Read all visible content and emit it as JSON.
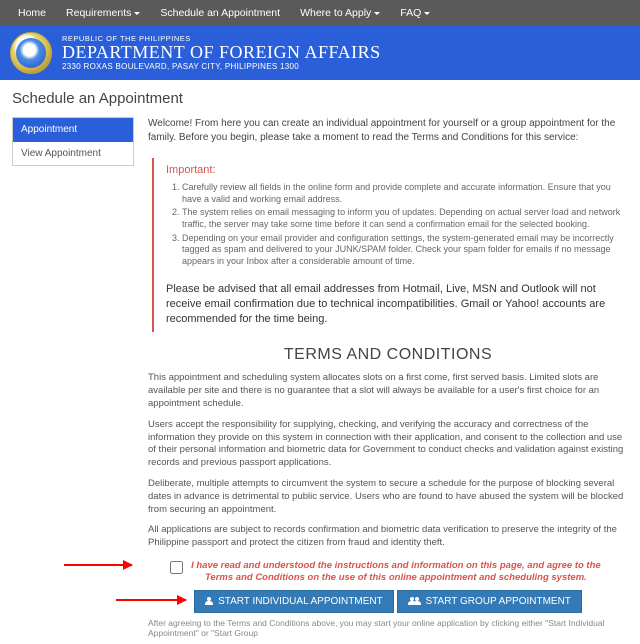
{
  "nav": {
    "home": "Home",
    "requirements": "Requirements",
    "schedule": "Schedule an Appointment",
    "where": "Where to Apply",
    "faq": "FAQ"
  },
  "banner": {
    "sup": "REPUBLIC OF THE PHILIPPINES",
    "title": "DEPARTMENT OF FOREIGN AFFAIRS",
    "addr": "2330 ROXAS BOULEVARD, PASAY CITY, PHILIPPINES 1300"
  },
  "page_title": "Schedule an Appointment",
  "side": {
    "appointment": "Appointment",
    "view": "View Appointment"
  },
  "welcome": "Welcome! From here you can create an individual appointment for yourself or a group appointment for the family. Before you begin, please take a moment to read the Terms and Conditions for this service:",
  "important": {
    "heading": "Important:",
    "items": [
      "Carefully review all fields in the online form and provide complete and accurate information. Ensure that you have a valid and working email address.",
      "The system relies on email messaging to inform you of updates. Depending on actual server load and network traffic, the server may take some time before it can send a confirmation email for the selected booking.",
      "Depending on your email provider and configuration settings, the system-generated email may be incorrectly tagged as spam and delivered to your JUNK/SPAM folder. Check your spam folder for emails if no message appears in your Inbox after a considerable amount of time."
    ],
    "advisory": "Please be advised that all email addresses from Hotmail, Live, MSN and Outlook will not receive email confirmation due to technical incompatibilities. Gmail or Yahoo! accounts are recommended for the time being."
  },
  "tc": {
    "heading": "TERMS AND CONDITIONS",
    "p1": "This appointment and scheduling system allocates slots on a first come, first served basis. Limited slots are available per site and there is no guarantee that a slot will always be available for a user's first choice for an appointment schedule.",
    "p2": "Users accept the responsibility for supplying, checking, and verifying the accuracy and correctness of the information they provide on this system in connection with their application, and consent to the collection and use of their personal information and biometric data for Government to conduct checks and validation against existing records and previous passport applications.",
    "p3": "Deliberate, multiple attempts to circumvent the system to secure a schedule for the purpose of blocking several dates in advance is detrimental to public service. Users who are found to have abused the system will be blocked from securing an appointment.",
    "p4": "All applications are subject to records confirmation and biometric data verification to preserve the integrity of the Philippine passport and protect the citizen from fraud and identity theft."
  },
  "agree": "I have read and understood the instructions and information on this page, and agree to the Terms and Conditions on the use of this online appointment and scheduling system.",
  "buttons": {
    "individual": "START INDIVIDUAL APPOINTMENT",
    "group": "START GROUP APPOINTMENT"
  },
  "foot": "After agreeing to the Terms and Conditions above, you may start your online application by clicking either \"Start Individual Appointment\" or \"Start Group"
}
